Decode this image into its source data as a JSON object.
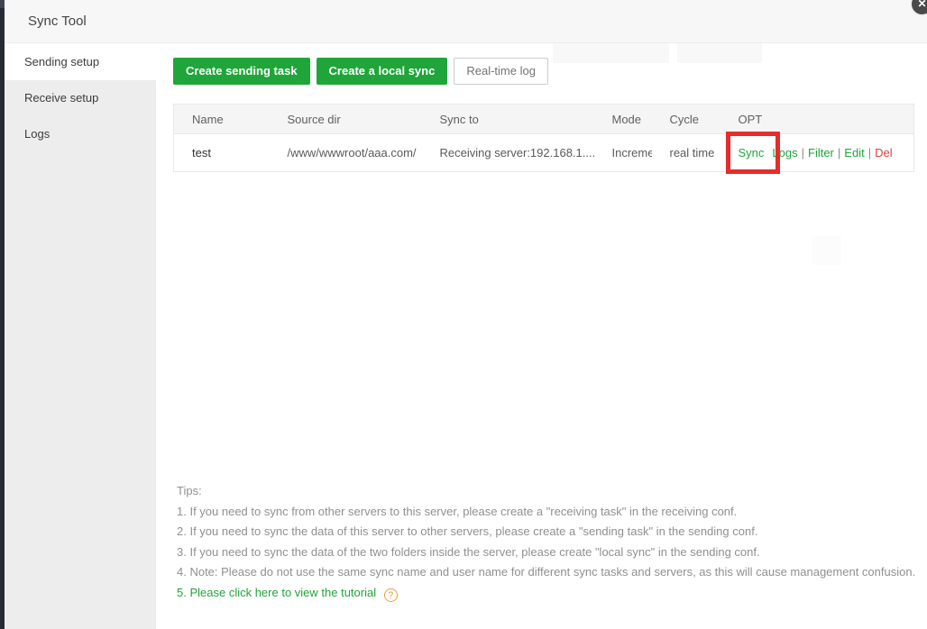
{
  "window": {
    "title": "Sync Tool",
    "close_icon": "✕"
  },
  "sidebar": {
    "items": [
      {
        "label": "Sending setup",
        "active": true
      },
      {
        "label": "Receive setup",
        "active": false
      },
      {
        "label": "Logs",
        "active": false
      }
    ]
  },
  "toolbar": {
    "create_sending": "Create sending task",
    "create_local": "Create a local sync",
    "realtime_log": "Real-time log"
  },
  "table": {
    "columns": [
      "Name",
      "Source dir",
      "Sync to",
      "Mode",
      "Cycle",
      "OPT"
    ],
    "row": {
      "name": "test",
      "source_dir": "/www/wwwroot/aaa.com/",
      "sync_to": "Receiving server:192.168.1....",
      "mode": "Increment",
      "cycle": "real time",
      "separator": "|",
      "actions": {
        "sync": "Sync",
        "logs": "Logs",
        "filter": "Filter",
        "edit": "Edit",
        "del": "Del"
      }
    }
  },
  "annotation": {
    "type": "red-highlight-box",
    "target": "Sync",
    "color": "#e62c2c"
  },
  "tips": {
    "heading": "Tips:",
    "lines": [
      "1. If you need to sync from other servers to this server, please create a \"receiving task\" in the receiving conf.",
      "2. If you need to sync the data of this server to other servers, please create a \"sending task\" in the sending conf.",
      "3. If you need to sync the data of the two folders inside the server, please create \"local sync\" in the sending conf.",
      "4. Note: Please do not use the same sync name and user name for different sync tasks and servers, as this will cause management confusion."
    ],
    "tutorial": "5. Please click here to view the tutorial",
    "help_icon": "?"
  },
  "colors": {
    "accent_green": "#20a53a",
    "danger_red": "#e13f3f",
    "highlight_red": "#e62c2c",
    "sidebar_gray": "#ededed",
    "header_gray": "#f7f7f7"
  }
}
